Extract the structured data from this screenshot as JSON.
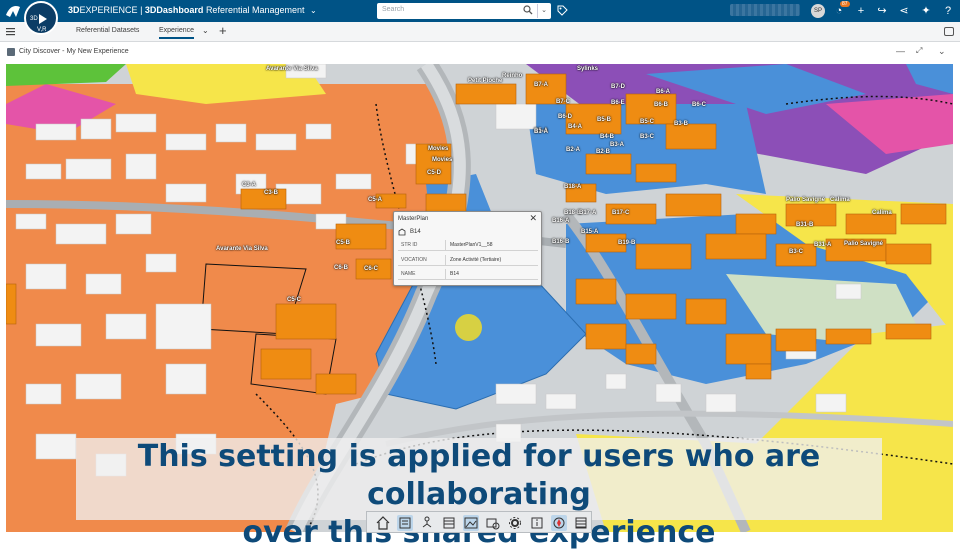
{
  "topbar": {
    "brand_3d": "3D",
    "brand_experience": "EXPERIENCE",
    "app": "3DDashboard",
    "dashboard": "Referential Management",
    "search_placeholder": "Search",
    "compass_labels": [
      "3D",
      "V,R"
    ],
    "avatar_initials": "SP",
    "notification_count": "87"
  },
  "tabs": [
    {
      "label": "Referential Datasets",
      "active": false
    },
    {
      "label": "Experience",
      "active": true
    }
  ],
  "widget": {
    "title": "City Discover - My New Experience"
  },
  "popup": {
    "title": "MasterPlan",
    "name": "B14",
    "rows": [
      {
        "key": "STR ID",
        "value": "MasterPlanV1__58"
      },
      {
        "key": "VOCATION",
        "value": "Zone Activité (Tertiaire)"
      },
      {
        "key": "NAME",
        "value": "B14"
      }
    ]
  },
  "map_labels": [
    "Avarante Via Silva",
    "Avarante Via Silva",
    "C3-A",
    "C3-B",
    "C5-A",
    "C5-B",
    "C6-B",
    "C6-C",
    "C5-C",
    "C5-D",
    "Movies",
    "Movies",
    "B7-A",
    "B7-C",
    "B7-D",
    "B6-A",
    "B6-B",
    "B6-C",
    "B6-D",
    "B6-E",
    "B5-A",
    "B5-B",
    "B5-C",
    "B4-A",
    "B4-B",
    "B3-A",
    "B3-B",
    "B3-C",
    "B1-A",
    "B2-A",
    "B2-B",
    "B18-A",
    "B18-B",
    "B17-A",
    "B17-C",
    "B16-A",
    "B16-B",
    "B15-A",
    "B19-B",
    "Sylinks",
    "Reinho",
    "Petit Pioche",
    "Palio Savigné",
    "Palio Savigné",
    "Calima",
    "Calima",
    "B31-B",
    "B31-A",
    "B3-C"
  ],
  "subtitle": {
    "line1": "This setting is applied for users who are collaborating",
    "line2": "over this shared experience"
  },
  "bottom_toolbar": [
    "home-icon",
    "layers-icon",
    "tree-icon",
    "list-icon",
    "picture-icon",
    "capture-icon",
    "settings-icon",
    "info-icon",
    "compass-icon",
    "table-icon"
  ],
  "colors": {
    "brand_bar": "#005386",
    "zone_orange": "#f08a4b",
    "zone_blue": "#4a90d9",
    "zone_yellow": "#f6e54a",
    "zone_magenta": "#d84ea3",
    "zone_purple": "#8c4fb7",
    "building_orange": "#ef8c12",
    "subtitle_text": "#0e4a79"
  }
}
